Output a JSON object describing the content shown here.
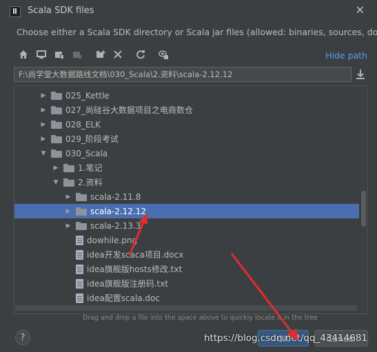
{
  "window": {
    "title": "Scala SDK files"
  },
  "description": "Choose either a Scala SDK directory or Scala jar files (allowed: binaries, sources, docs)",
  "toolbar": {
    "icons": [
      "home-icon",
      "desktop-icon",
      "project-icon",
      "module-icon",
      "new-folder-icon",
      "delete-icon",
      "refresh-icon",
      "show-hidden-icon"
    ],
    "hide_path": "Hide path"
  },
  "path": {
    "value": "F:\\尚学堂大数据路线文档\\030_Scala\\2.资料\\scala-2.12.12"
  },
  "tree": {
    "rows": [
      {
        "label": "025_Kettle",
        "type": "folder",
        "level": 3,
        "expanded": false
      },
      {
        "label": "027_尚硅谷大数据项目之电商数仓",
        "type": "folder",
        "level": 3,
        "expanded": false
      },
      {
        "label": "028_ELK",
        "type": "folder",
        "level": 3,
        "expanded": false
      },
      {
        "label": "029_阶段考试",
        "type": "folder",
        "level": 3,
        "expanded": false
      },
      {
        "label": "030_Scala",
        "type": "folder",
        "level": 3,
        "expanded": true
      },
      {
        "label": "1.笔记",
        "type": "folder",
        "level": 4,
        "expanded": false
      },
      {
        "label": "2.资料",
        "type": "folder",
        "level": 4,
        "expanded": true
      },
      {
        "label": "scala-2.11.8",
        "type": "folder",
        "level": 5,
        "expanded": false
      },
      {
        "label": "scala-2.12.12",
        "type": "folder",
        "level": 5,
        "expanded": false,
        "selected": true
      },
      {
        "label": "scala-2.13.3",
        "type": "folder",
        "level": 5,
        "expanded": false
      },
      {
        "label": "dowhile.png",
        "type": "file",
        "level": 5
      },
      {
        "label": "idea开发scaca项目.docx",
        "type": "file",
        "level": 5
      },
      {
        "label": "idea旗舰版hosts修改.txt",
        "type": "file",
        "level": 5
      },
      {
        "label": "idea旗舰版注册码.txt",
        "type": "file",
        "level": 5
      },
      {
        "label": "idea配置scala.doc",
        "type": "file",
        "level": 5
      }
    ]
  },
  "hint": "Drag and drop a file into the space above to quickly locate it in the tree",
  "buttons": {
    "help": "?",
    "ok": "OK",
    "cancel": "Cancel"
  },
  "watermark": "https://blog.csdn.net/qq_43414681",
  "colors": {
    "background": "#3c3f41",
    "selection": "#4b6eaf",
    "link": "#589df6",
    "annotation_arrow": "#e02d2d"
  }
}
